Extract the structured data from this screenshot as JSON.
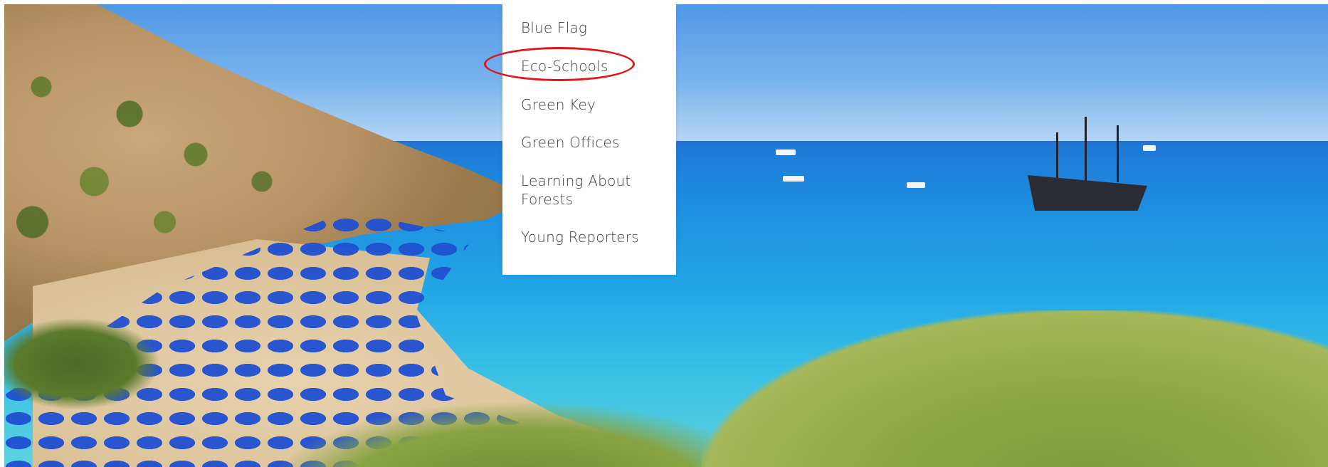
{
  "dropdown": {
    "items": [
      {
        "label": "Blue Flag"
      },
      {
        "label": "Eco-Schools"
      },
      {
        "label": "Green Key"
      },
      {
        "label": "Green Offices"
      },
      {
        "label": "Learning About Forests"
      },
      {
        "label": "Young Reporters"
      }
    ],
    "highlighted_item": "Eco-Schools"
  },
  "colors": {
    "menu_background": "#ffffff",
    "menu_text": "#3e3e3e",
    "highlight_ring": "#e0161c"
  },
  "hero": {
    "description_icon": "beach-photo"
  }
}
